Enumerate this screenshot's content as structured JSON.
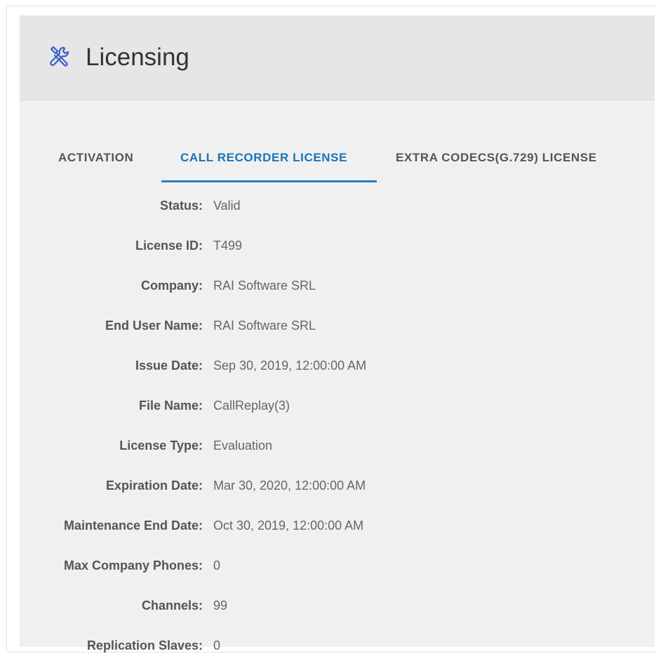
{
  "header": {
    "icon": "tools-icon",
    "title": "Licensing"
  },
  "tabs": [
    {
      "label": "ACTIVATION",
      "active": false
    },
    {
      "label": "CALL RECORDER LICENSE",
      "active": true
    },
    {
      "label": "EXTRA CODECS(G.729) LICENSE",
      "active": false
    }
  ],
  "colors": {
    "accent": "#2a7ec4",
    "icon": "#3b5fc4"
  },
  "fields": [
    {
      "label": "Status:",
      "value": "Valid"
    },
    {
      "label": "License ID:",
      "value": "T499"
    },
    {
      "label": "Company:",
      "value": "RAI Software SRL"
    },
    {
      "label": "End User Name:",
      "value": "RAI Software SRL"
    },
    {
      "label": "Issue Date:",
      "value": "Sep 30, 2019, 12:00:00 AM"
    },
    {
      "label": "File Name:",
      "value": "CallReplay(3)"
    },
    {
      "label": "License Type:",
      "value": "Evaluation"
    },
    {
      "label": "Expiration Date:",
      "value": "Mar 30, 2020, 12:00:00 AM"
    },
    {
      "label": "Maintenance End Date:",
      "value": "Oct 30, 2019, 12:00:00 AM"
    },
    {
      "label": "Max Company Phones:",
      "value": "0"
    },
    {
      "label": "Channels:",
      "value": "99"
    },
    {
      "label": "Replication Slaves:",
      "value": "0"
    }
  ]
}
